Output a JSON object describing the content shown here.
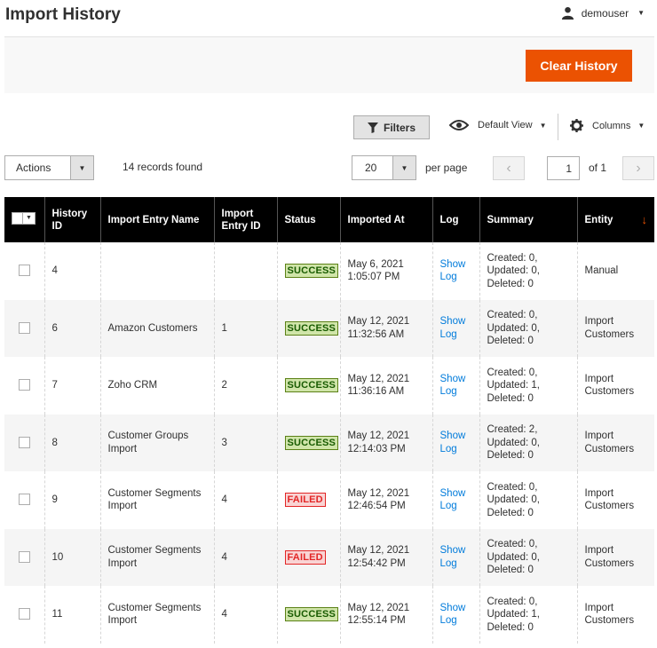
{
  "header": {
    "title": "Import History",
    "username": "demouser"
  },
  "action_bar": {
    "clear_history": "Clear History"
  },
  "toolbar": {
    "filters": "Filters",
    "default_view": "Default View",
    "columns": "Columns",
    "actions": "Actions",
    "records_found": "14 records found",
    "per_page_value": "20",
    "per_page_label": "per page",
    "page_value": "1",
    "page_of": "of 1"
  },
  "icons": {
    "user": "user-icon",
    "filter": "filter-icon",
    "eye": "eye-icon",
    "gear": "gear-icon"
  },
  "colors": {
    "accent": "#eb5202",
    "success": "#185b00",
    "failed": "#e22626",
    "link": "#007bdb"
  },
  "table": {
    "columns": [
      "History ID",
      "Import Entry Name",
      "Import Entry ID",
      "Status",
      "Imported At",
      "Log",
      "Summary",
      "Entity"
    ],
    "rows": [
      {
        "id": "4",
        "name": "",
        "entry_id": "",
        "status": "SUCCESS",
        "date": "May 6, 2021",
        "time": "1:05:07 PM",
        "log1": "Show",
        "log2": "Log",
        "created": "Created: 0,",
        "updated": "Updated: 0,",
        "deleted": "Deleted: 0",
        "entity1": "Manual",
        "entity2": ""
      },
      {
        "id": "6",
        "name": "Amazon Customers",
        "entry_id": "1",
        "status": "SUCCESS",
        "date": "May 12, 2021",
        "time": "11:32:56 AM",
        "log1": "Show",
        "log2": "Log",
        "created": "Created: 0,",
        "updated": "Updated: 0,",
        "deleted": "Deleted: 0",
        "entity1": "Import",
        "entity2": "Customers"
      },
      {
        "id": "7",
        "name": "Zoho CRM",
        "entry_id": "2",
        "status": "SUCCESS",
        "date": "May 12, 2021",
        "time": "11:36:16 AM",
        "log1": "Show",
        "log2": "Log",
        "created": "Created: 0,",
        "updated": "Updated: 1,",
        "deleted": "Deleted: 0",
        "entity1": "Import",
        "entity2": "Customers"
      },
      {
        "id": "8",
        "name": "Customer Groups Import",
        "entry_id": "3",
        "status": "SUCCESS",
        "date": "May 12, 2021",
        "time": "12:14:03 PM",
        "log1": "Show",
        "log2": "Log",
        "created": "Created: 2,",
        "updated": "Updated: 0,",
        "deleted": "Deleted: 0",
        "entity1": "Import",
        "entity2": "Customers"
      },
      {
        "id": "9",
        "name": "Customer Segments Import",
        "entry_id": "4",
        "status": "FAILED",
        "date": "May 12, 2021",
        "time": "12:46:54 PM",
        "log1": "Show",
        "log2": "Log",
        "created": "Created: 0,",
        "updated": "Updated: 0,",
        "deleted": "Deleted: 0",
        "entity1": "Import",
        "entity2": "Customers"
      },
      {
        "id": "10",
        "name": "Customer Segments Import",
        "entry_id": "4",
        "status": "FAILED",
        "date": "May 12, 2021",
        "time": "12:54:42 PM",
        "log1": "Show",
        "log2": "Log",
        "created": "Created: 0,",
        "updated": "Updated: 0,",
        "deleted": "Deleted: 0",
        "entity1": "Import",
        "entity2": "Customers"
      },
      {
        "id": "11",
        "name": "Customer Segments Import",
        "entry_id": "4",
        "status": "SUCCESS",
        "date": "May 12, 2021",
        "time": "12:55:14 PM",
        "log1": "Show",
        "log2": "Log",
        "created": "Created: 0,",
        "updated": "Updated: 1,",
        "deleted": "Deleted: 0",
        "entity1": "Import",
        "entity2": "Customers"
      }
    ]
  }
}
